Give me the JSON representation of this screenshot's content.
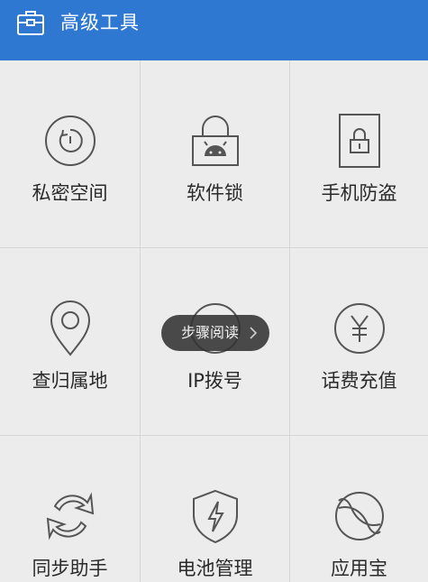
{
  "header": {
    "title": "高级工具",
    "icon": "toolbox-icon",
    "color": "#2f78d2"
  },
  "tools": [
    {
      "label": "私密空间",
      "icon": "private-space-icon"
    },
    {
      "label": "软件锁",
      "icon": "app-lock-icon"
    },
    {
      "label": "手机防盗",
      "icon": "anti-theft-icon"
    },
    {
      "label": "查归属地",
      "icon": "location-pin-icon"
    },
    {
      "label": "IP拨号",
      "icon": "ip-dial-icon"
    },
    {
      "label": "话费充值",
      "icon": "yen-recharge-icon"
    },
    {
      "label": "同步助手",
      "icon": "sync-icon"
    },
    {
      "label": "电池管理",
      "icon": "battery-shield-icon"
    },
    {
      "label": "应用宝",
      "icon": "app-store-icon"
    }
  ],
  "toast": {
    "text": "步骤阅读",
    "icon": "chevron-right-icon"
  }
}
